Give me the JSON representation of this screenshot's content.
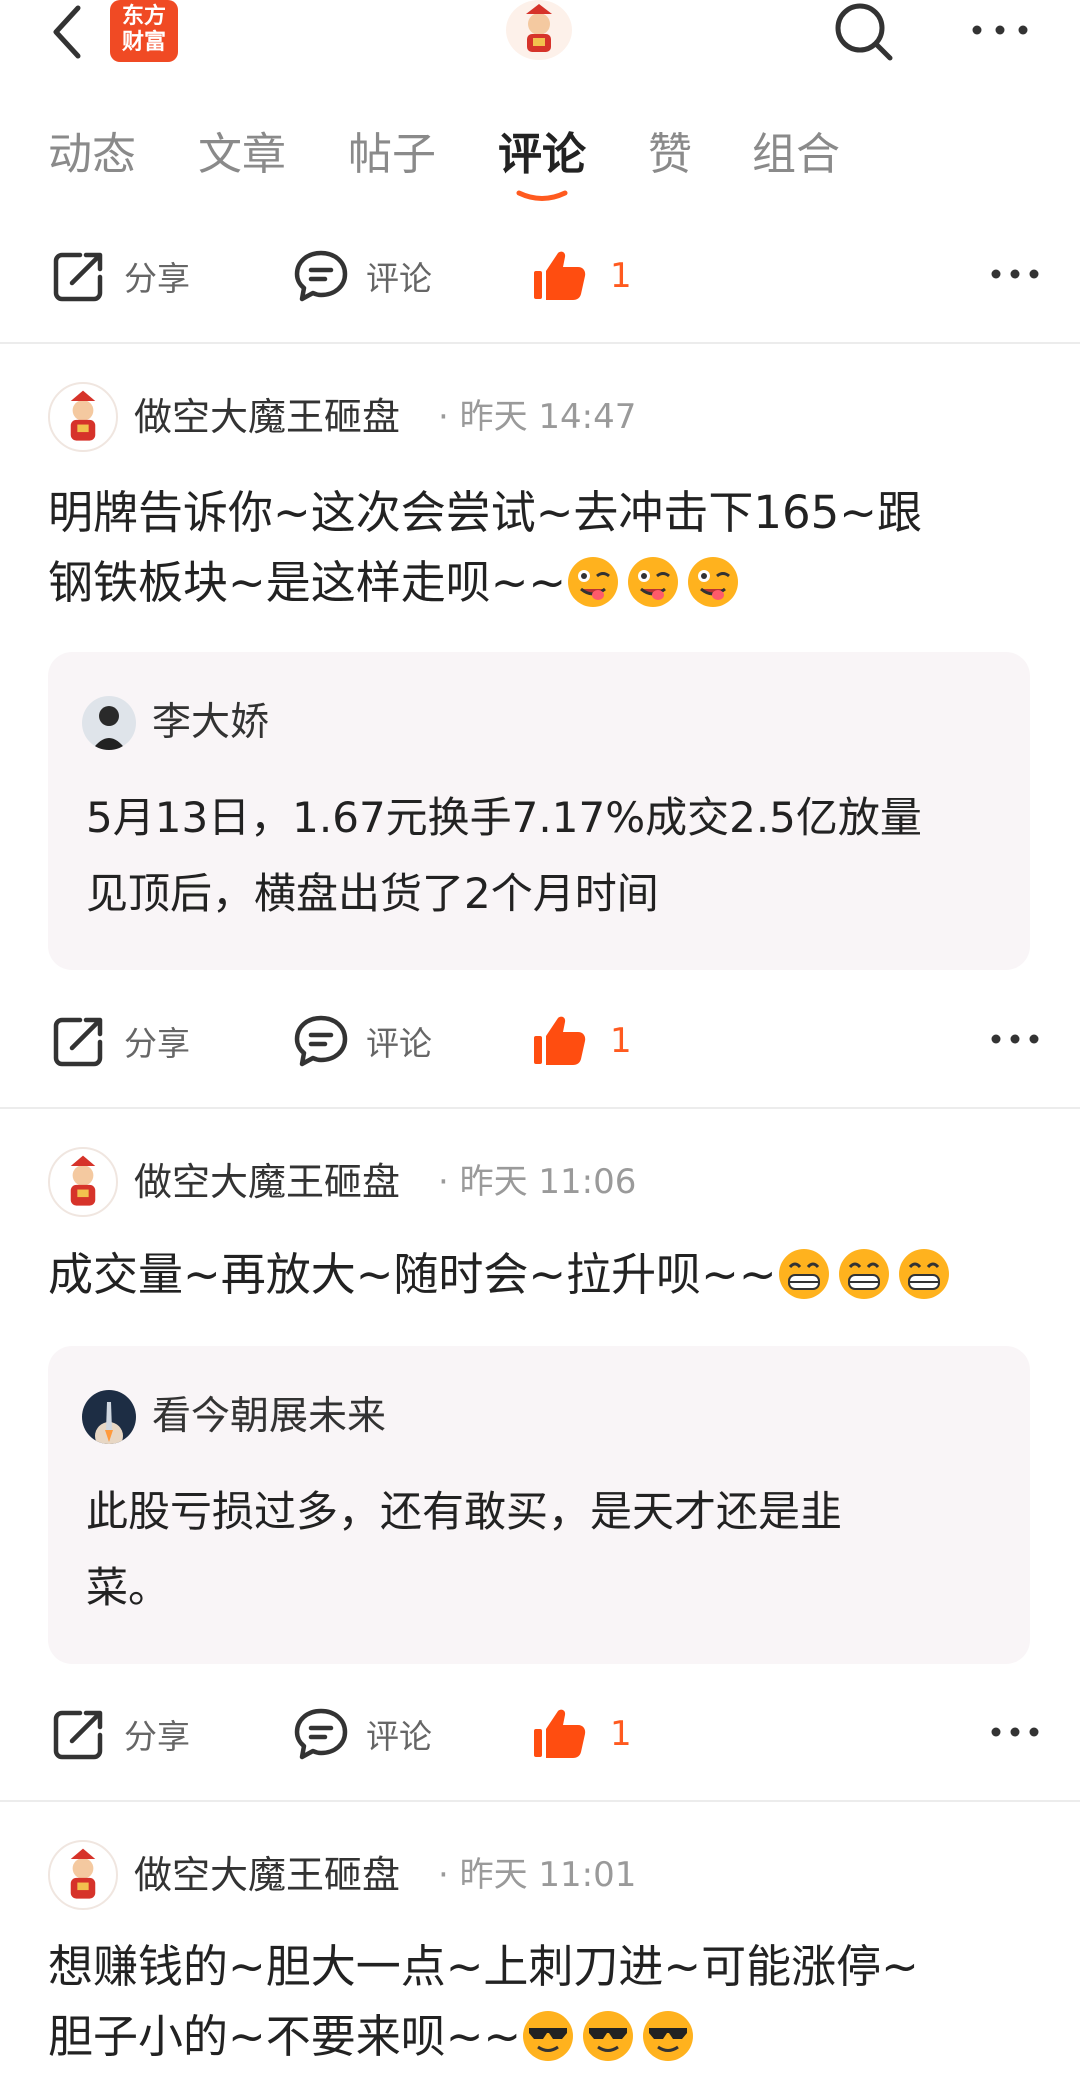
{
  "app": {
    "logo_line1": "东方",
    "logo_line2": "财富"
  },
  "tabs": [
    "动态",
    "文章",
    "帖子",
    "评论",
    "赞",
    "组合"
  ],
  "active_tab": "评论",
  "actions": {
    "share": "分享",
    "comment": "评论",
    "like_count": "1"
  },
  "posts": [
    {
      "author": "做空大魔王砸盘",
      "time": "· 昨天 14:47",
      "line1": "明牌告诉你~这次会尝试~去冲击下165~跟",
      "line2": "钢铁板块~是这样走呗~~",
      "emoji": "wink-tongue",
      "quote": {
        "author": "李大娇",
        "line1": "5月13日，1.67元换手7.17%成交2.5亿放量",
        "line2": "见顶后，横盘出货了2个月时间"
      }
    },
    {
      "author": "做空大魔王砸盘",
      "time": "· 昨天 11:06",
      "line1": "成交量~再放大~随时会~拉升呗~~",
      "emoji": "grin",
      "quote": {
        "author": "看今朝展未来",
        "line1": "此股亏损过多，还有敢买，是天才还是韭",
        "line2": "菜。"
      }
    },
    {
      "author": "做空大魔王砸盘",
      "time": "· 昨天 11:01",
      "line1": "想赚钱的~胆大一点~上刺刀进~可能涨停~",
      "line2": "胆子小的~不要来呗~~",
      "emoji": "sunglasses"
    }
  ],
  "colors": {
    "accent": "#ff5a1f",
    "brand": "#f04a24",
    "quote_bg": "#f9f5f7"
  }
}
